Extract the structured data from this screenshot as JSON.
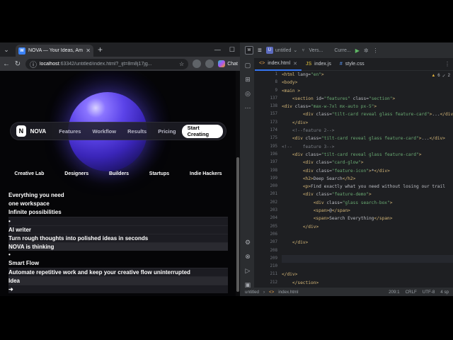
{
  "browser": {
    "tab_title": "NOVA — Your Ideas, Amplified",
    "url_host": "localhost",
    "url_rest": ":63342/untitled/index.html?_ijt=8m8j17jg...",
    "chat_label": "Chat"
  },
  "site": {
    "logo_letter": "N",
    "brand": "NOVA",
    "nav": [
      "Features",
      "Workflow",
      "Results",
      "Pricing"
    ],
    "cta": "Start Creating",
    "audience": [
      "Creative Lab",
      "Designers",
      "Builders",
      "Startups",
      "Indie Hackers"
    ],
    "lines": [
      {
        "text": "Everything you need",
        "style": "plain"
      },
      {
        "text": "one workspace",
        "style": "plain"
      },
      {
        "text": "Infinite possibilities",
        "style": "plain"
      },
      {
        "text": "•",
        "style": "boxed"
      },
      {
        "text": "AI writer",
        "style": "boxed"
      },
      {
        "text": "Turn rough thoughts into polished ideas in seconds",
        "style": "boxed"
      },
      {
        "text": "NOVA is thinking",
        "style": "boxed-dark"
      },
      {
        "text": "•",
        "style": "plain"
      },
      {
        "text": "Smart Flow",
        "style": "plain"
      },
      {
        "text": "Automate repetitive work and keep your creative flow uninterrupted",
        "style": "boxed"
      },
      {
        "text": "Idea",
        "style": "boxed-dark"
      },
      {
        "text": "➜",
        "style": "boxed"
      }
    ]
  },
  "ide": {
    "project": "untitled",
    "version": "Vers...",
    "config": "Curre...",
    "tabs": [
      {
        "label": "index.html",
        "type": "html",
        "active": true
      },
      {
        "label": "index.js",
        "type": "js",
        "active": false
      },
      {
        "label": "style.css",
        "type": "css",
        "active": false
      }
    ],
    "inspections": {
      "warnings": "6",
      "weak": "2"
    },
    "lines": [
      {
        "n": "1",
        "code": "<html lang=\"en\">"
      },
      {
        "n": "8",
        "code": "<body>"
      },
      {
        "n": "9",
        "code": "<main >"
      },
      {
        "n": "137",
        "code": "    <section id=\"features\" class=\"section\">"
      },
      {
        "n": "138",
        "code": "<div class=\"max-w-7xl mx-auto px-5\">"
      },
      {
        "n": "157",
        "code": "        <div class=\"tilt-card reveal glass feature-card\">...</div>"
      },
      {
        "n": "173",
        "code": "    </div>"
      },
      {
        "n": "174",
        "code": "    <!--feature 2-->"
      },
      {
        "n": "175",
        "code": "    <div class=\"tilt-card reveal glass feature-card\">...</div>"
      },
      {
        "n": "195",
        "code": "<!--    feature 3-->"
      },
      {
        "n": "196",
        "code": "    <div class=\"tilt-card reveal glass feature-card\">"
      },
      {
        "n": "197",
        "code": "        <div class=\"card-glow\">"
      },
      {
        "n": "198",
        "code": "        <div class=\"feature-icon\">*</div>"
      },
      {
        "n": "199",
        "code": "        <h2>Deep Search</h2>"
      },
      {
        "n": "200",
        "code": "        <p>Find exactly what you need without losing our trail"
      },
      {
        "n": "201",
        "code": "        <div class=\"feature-demo\">"
      },
      {
        "n": "202",
        "code": "            <div class=\"glass search-box\">"
      },
      {
        "n": "203",
        "code": "            <span>@</span>"
      },
      {
        "n": "204",
        "code": "            <span>Search Everything</span>"
      },
      {
        "n": "205",
        "code": "        </div>"
      },
      {
        "n": "206",
        "code": ""
      },
      {
        "n": "207",
        "code": "    </div>"
      },
      {
        "n": "208",
        "code": ""
      },
      {
        "n": "209",
        "code": ""
      },
      {
        "n": "210",
        "code": ""
      },
      {
        "n": "211",
        "code": "</div>"
      },
      {
        "n": "212",
        "code": "    </section>"
      }
    ],
    "status": {
      "path_project": "untitled",
      "path_file": "index.html",
      "position": "209:1",
      "line_sep": "CRLF",
      "encoding": "UTF-8",
      "indent": "4 sp"
    }
  }
}
